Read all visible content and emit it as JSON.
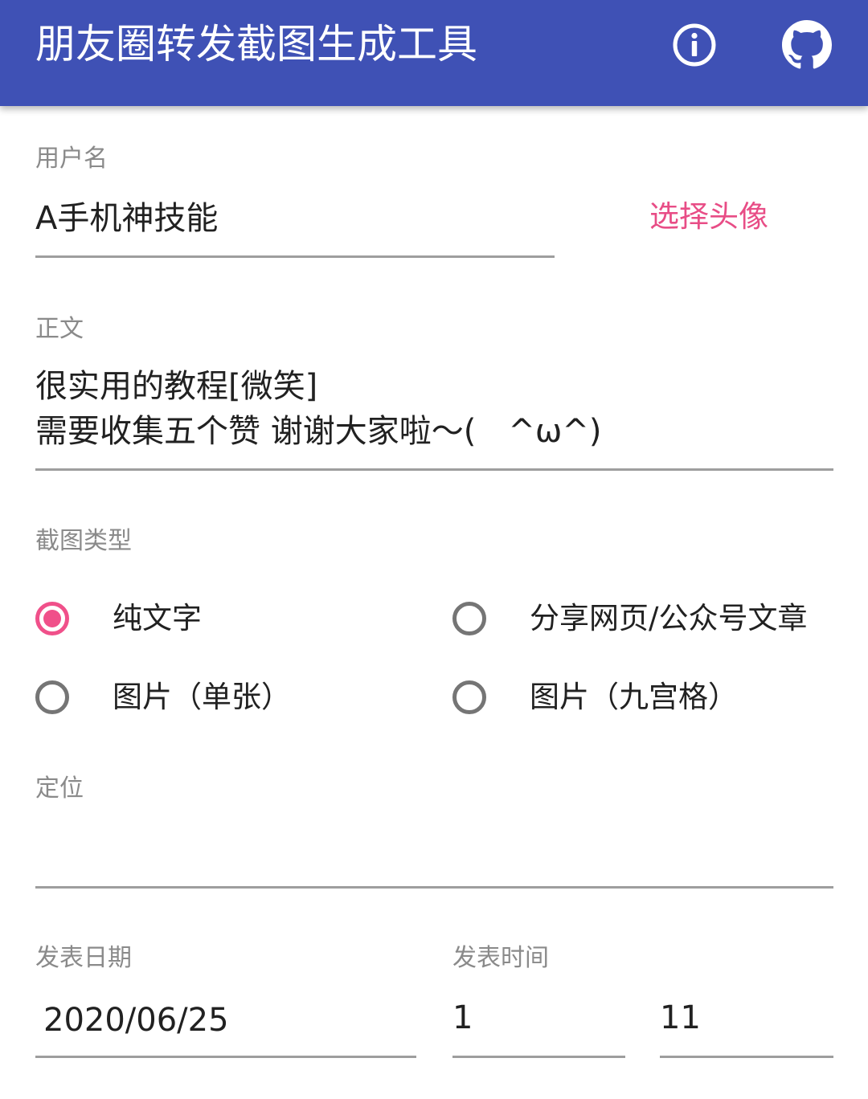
{
  "appbar": {
    "title": "朋友圈转发截图生成工具",
    "info_icon": "info-circle-icon",
    "github_icon": "github-icon",
    "color": "#3f51b5"
  },
  "username": {
    "label": "用户名",
    "value": "A手机神技能",
    "choose_avatar_label": "选择头像"
  },
  "body": {
    "label": "正文",
    "line1": "很实用的教程[微笑]",
    "line2": "需要收集五个赞 谢谢大家啦～(　^ω^)"
  },
  "screenshot_type": {
    "label": "截图类型",
    "options": [
      {
        "label": "纯文字",
        "checked": true
      },
      {
        "label": "分享网页/公众号文章",
        "checked": false
      },
      {
        "label": "图片（单张）",
        "checked": false
      },
      {
        "label": "图片（九宫格）",
        "checked": false
      }
    ]
  },
  "location": {
    "label": "定位",
    "value": ""
  },
  "publish_date": {
    "label": "发表日期",
    "value": "2020/06/25"
  },
  "publish_time": {
    "label": "发表时间",
    "hour": "1",
    "minute": "11"
  },
  "colors": {
    "primary": "#3f51b5",
    "accent": "#f0508a",
    "link": "#e84d86"
  }
}
